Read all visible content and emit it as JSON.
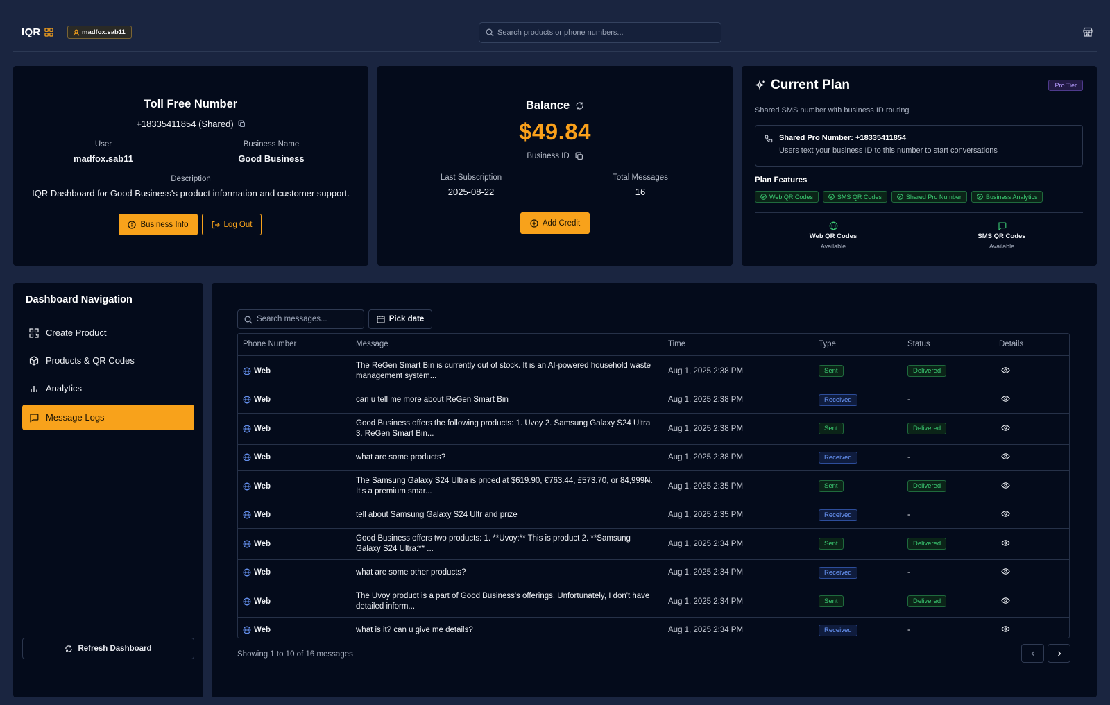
{
  "header": {
    "logo": "IQR",
    "username": "madfox.sab11",
    "search_placeholder": "Search products or phone numbers...",
    "icons": [
      "grid-icon",
      "user-icon",
      "search-icon",
      "store-icon"
    ]
  },
  "toll_free": {
    "title": "Toll Free Number",
    "number": "+18335411854 (Shared)",
    "user_label": "User",
    "user_value": "madfox.sab11",
    "business_label": "Business Name",
    "business_value": "Good Business",
    "description_label": "Description",
    "description_value": "IQR Dashboard for Good Business's product information and customer support.",
    "business_info_button": "Business Info",
    "logout_button": "Log Out"
  },
  "balance": {
    "title": "Balance",
    "amount": "$49.84",
    "business_id_label": "Business ID",
    "last_sub_label": "Last Subscription",
    "last_sub_value": "2025-08-22",
    "total_msg_label": "Total Messages",
    "total_msg_value": "16",
    "add_credit_button": "Add Credit"
  },
  "plan": {
    "title": "Current Plan",
    "badge": "Pro Tier",
    "subtitle": "Shared SMS number with business ID routing",
    "shared_title": "Shared Pro Number: +18335411854",
    "shared_desc": "Users text your business ID to this number to start conversations",
    "features_label": "Plan Features",
    "features": [
      "Web QR Codes",
      "SMS QR Codes",
      "Shared Pro Number",
      "Business Analytics"
    ],
    "web_qr_label": "Web QR Codes",
    "web_qr_status": "Available",
    "sms_qr_label": "SMS QR Codes",
    "sms_qr_status": "Available"
  },
  "nav": {
    "title": "Dashboard Navigation",
    "items": [
      {
        "label": "Create Product",
        "icon": "qr-icon"
      },
      {
        "label": "Products & QR Codes",
        "icon": "box-icon"
      },
      {
        "label": "Analytics",
        "icon": "bar-chart-icon"
      },
      {
        "label": "Message Logs",
        "icon": "message-icon"
      }
    ],
    "active_item": "Message Logs",
    "refresh_button": "Refresh Dashboard"
  },
  "logs": {
    "search_placeholder": "Search messages...",
    "pick_date_button": "Pick date",
    "columns": [
      "Phone Number",
      "Message",
      "Time",
      "Type",
      "Status",
      "Details"
    ],
    "rows": [
      {
        "phone": "Web",
        "message": "The ReGen Smart Bin is currently out of stock. It is an AI-powered household waste management system...",
        "time": "Aug 1, 2025 2:38 PM",
        "type": "Sent",
        "status": "Delivered"
      },
      {
        "phone": "Web",
        "message": "can u tell me more about ReGen Smart Bin",
        "time": "Aug 1, 2025 2:38 PM",
        "type": "Received",
        "status": "-"
      },
      {
        "phone": "Web",
        "message": "Good Business offers the following products: 1. Uvoy 2. Samsung Galaxy S24 Ultra 3. ReGen Smart Bin...",
        "time": "Aug 1, 2025 2:38 PM",
        "type": "Sent",
        "status": "Delivered"
      },
      {
        "phone": "Web",
        "message": "what are some products?",
        "time": "Aug 1, 2025 2:38 PM",
        "type": "Received",
        "status": "-"
      },
      {
        "phone": "Web",
        "message": "The Samsung Galaxy S24 Ultra is priced at $619.90, €763.44, £573.70, or 84,999₦. It's a premium smar...",
        "time": "Aug 1, 2025 2:35 PM",
        "type": "Sent",
        "status": "Delivered"
      },
      {
        "phone": "Web",
        "message": "tell about Samsung Galaxy S24 Ultr and prize",
        "time": "Aug 1, 2025 2:35 PM",
        "type": "Received",
        "status": "-"
      },
      {
        "phone": "Web",
        "message": "Good Business offers two products: 1. **Uvoy:** This is product 2. **Samsung Galaxy S24 Ultra:** ...",
        "time": "Aug 1, 2025 2:34 PM",
        "type": "Sent",
        "status": "Delivered"
      },
      {
        "phone": "Web",
        "message": "what are some other products?",
        "time": "Aug 1, 2025 2:34 PM",
        "type": "Received",
        "status": "-"
      },
      {
        "phone": "Web",
        "message": "The Uvoy product is a part of Good Business's offerings. Unfortunately, I don't have detailed inform...",
        "time": "Aug 1, 2025 2:34 PM",
        "type": "Sent",
        "status": "Delivered"
      },
      {
        "phone": "Web",
        "message": "what is it? can u give me details?",
        "time": "Aug 1, 2025 2:34 PM",
        "type": "Received",
        "status": "-"
      }
    ],
    "footer": "Showing 1 to 10 of 16 messages"
  },
  "colors": {
    "background": "#1a2540",
    "card": "#040b1b",
    "accent": "#f8a21b",
    "success": "#3ccc74",
    "info": "#6d9bff",
    "pro": "#b69cff"
  }
}
